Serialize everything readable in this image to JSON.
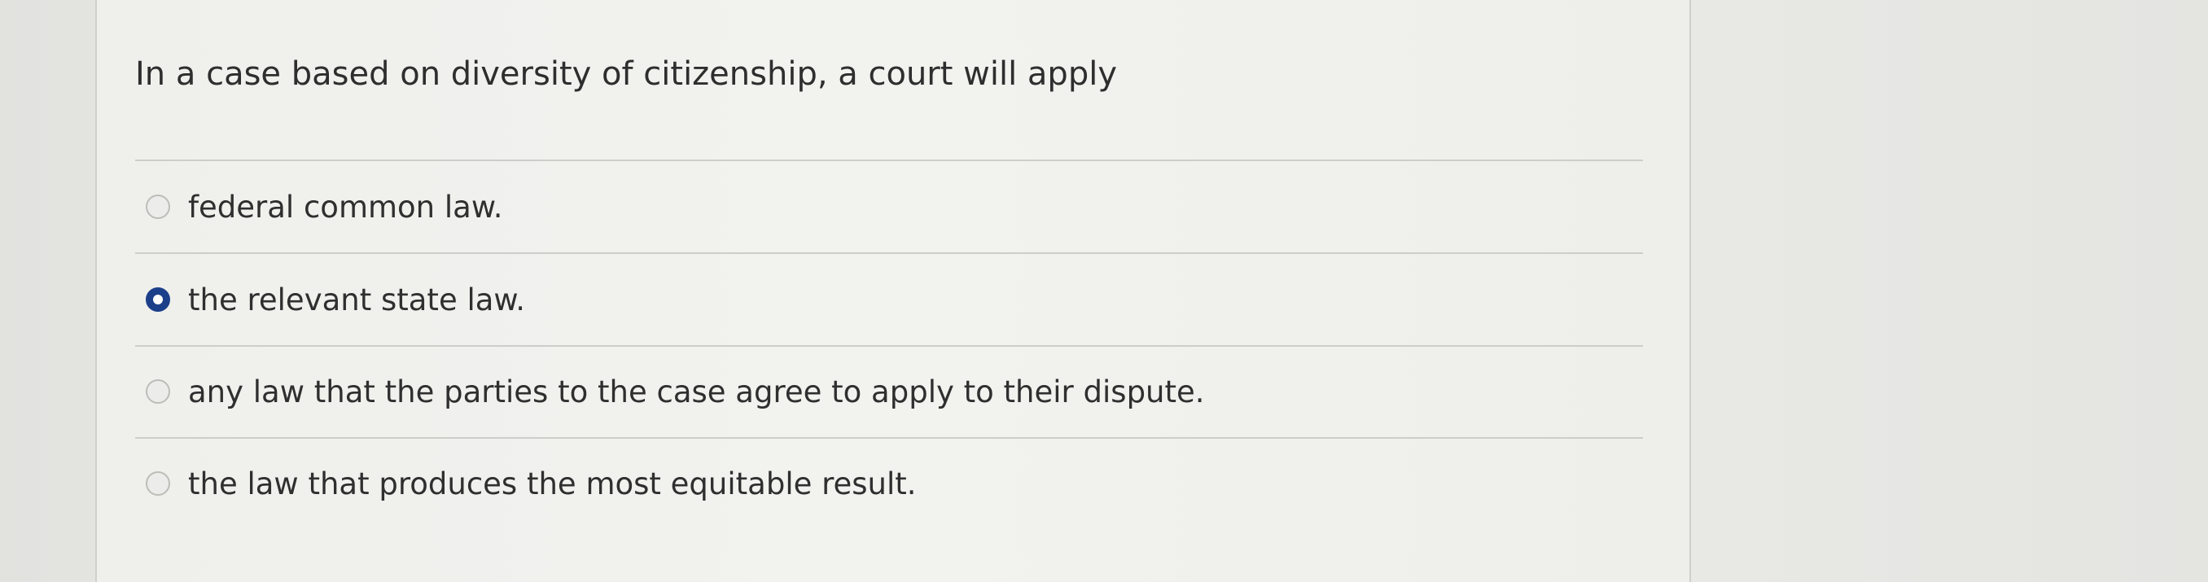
{
  "question": {
    "prompt": "In a case based on diversity of citizenship, a court will apply"
  },
  "options": [
    {
      "label": "federal common law.",
      "selected": false
    },
    {
      "label": "the relevant state law.",
      "selected": true
    },
    {
      "label": "any law that the parties to the case agree to apply to their dispute.",
      "selected": false
    },
    {
      "label": "the law that produces the most equitable result.",
      "selected": false
    }
  ],
  "colors": {
    "selected_radio": "#1c3f8a",
    "text": "#2f2f2f",
    "divider": "#cdcdc9"
  }
}
